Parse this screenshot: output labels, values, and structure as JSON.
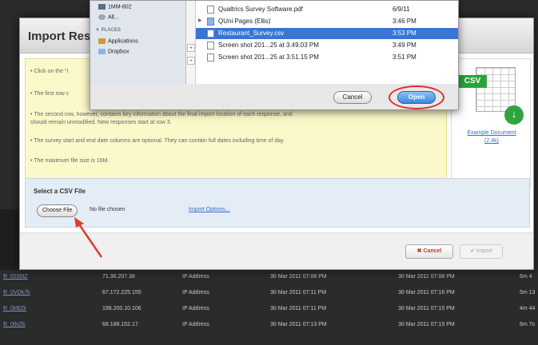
{
  "modal": {
    "title": "Import Res",
    "instructions": [
      "• Click on the \"I",
      "• The first row c",
      "• The second row, however, contains key information about the final import location of each response, and",
      "should remain unmodified. New responses start at row 3.",
      "• The survey start and end date columns are optional. They can contain full dates including time of day.",
      "• The maximum file size is 16M."
    ],
    "example": {
      "badge": "CSV",
      "link_line1": "Example Document",
      "link_line2": "(2.4k)"
    },
    "select": {
      "title": "Select a CSV File",
      "choose_label": "Choose File",
      "no_file_text": "No file chosen",
      "import_options": "Import Options..."
    },
    "footer": {
      "cancel_label": "✖ Cancel",
      "import_label": "✔ Import"
    }
  },
  "picker": {
    "sidebar": {
      "items_top": [
        {
          "label": "1MM-802",
          "icon": "computer-icon"
        },
        {
          "label": "All...",
          "icon": "network-icon"
        }
      ],
      "places_header": "▼ PLACES",
      "places": [
        {
          "label": "Applications",
          "icon": "applications-icon"
        },
        {
          "label": "Dropbox",
          "icon": "folder-icon"
        }
      ]
    },
    "files": [
      {
        "name": "Qualtrics Survey Software.pdf",
        "date": "6/9/11",
        "kind": "file",
        "selected": false
      },
      {
        "name": "QUni Pages (Ellis)",
        "date": "3:46 PM",
        "kind": "folder",
        "selected": false
      },
      {
        "name": "Restaurant_Survey.csv",
        "date": "3:53 PM",
        "kind": "file",
        "selected": true
      },
      {
        "name": "Screen shot 201...25 at 3.49.03 PM",
        "date": "3:49 PM",
        "kind": "file",
        "selected": false
      },
      {
        "name": "Screen shot 201...25 at 3.51.15 PM",
        "date": "3:51 PM",
        "kind": "file",
        "selected": false
      }
    ],
    "cancel_label": "Cancel",
    "open_label": "Open"
  },
  "background_table": {
    "rows": [
      [
        "R_0100tZ",
        "71.36.207.38",
        "IP Address",
        "30 Mar 2011 07:06 PM",
        "30 Mar 2011 07:08 PM",
        "6m 4"
      ],
      [
        "R_0VDk7k",
        "67.172.225.155",
        "IP Address",
        "30 Mar 2011 07:11 PM",
        "30 Mar 2011 07:16 PM",
        "5m 13"
      ],
      [
        "R_0kBZk",
        "198.200.10.106",
        "IP Address",
        "30 Mar 2011 07:11 PM",
        "30 Mar 2011 07:15 PM",
        "4m 44"
      ],
      [
        "R_0ifvZk",
        "68.188.152.17",
        "IP Address",
        "30 Mar 2011 07:13 PM",
        "30 Mar 2011 07:19 PM",
        "6m 7s"
      ]
    ]
  }
}
